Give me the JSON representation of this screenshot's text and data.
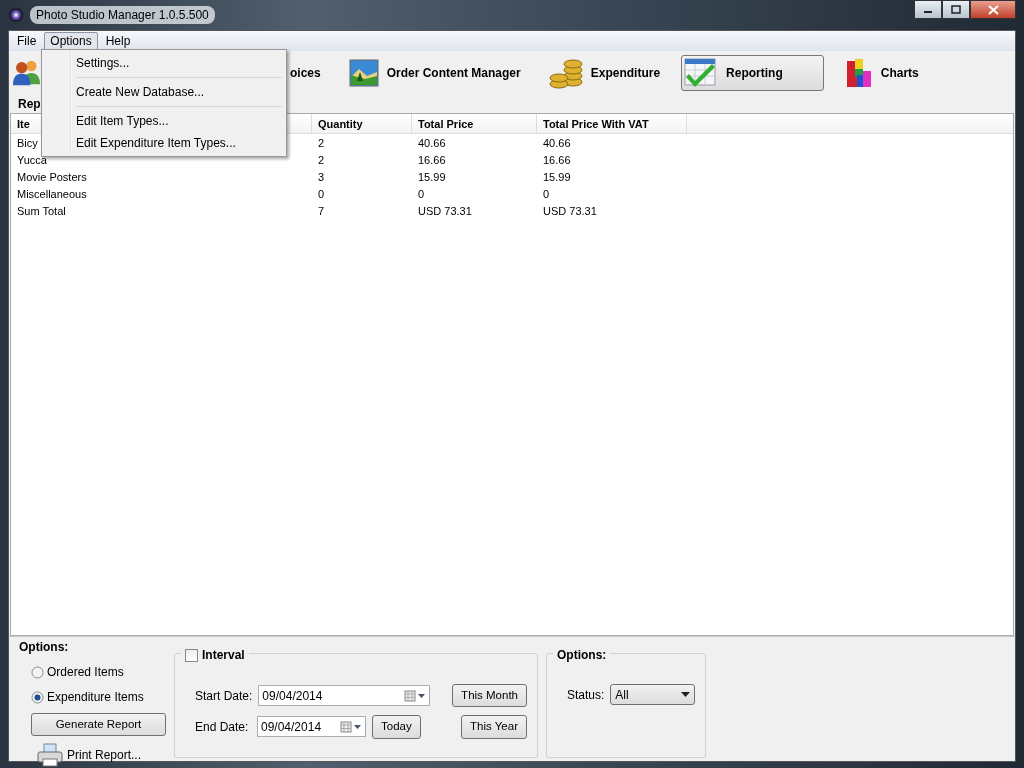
{
  "window": {
    "title": "Photo Studio Manager 1.0.5.500"
  },
  "menu_bar": [
    {
      "label": "File",
      "selected": false
    },
    {
      "label": "Options",
      "selected": true
    },
    {
      "label": "Help",
      "selected": false
    }
  ],
  "open_menu": {
    "groups": [
      [
        "Settings..."
      ],
      [
        "Create New Database..."
      ],
      [
        "Edit Item Types...",
        "Edit Expenditure Item Types..."
      ]
    ]
  },
  "toolbar": [
    {
      "kind": "people",
      "selected": false
    },
    {
      "kind": "text",
      "label": "oices",
      "selected": false
    },
    {
      "kind": "landscape",
      "label": "Order Content Manager",
      "selected": false
    },
    {
      "kind": "coins",
      "label": "Expenditure",
      "selected": false
    },
    {
      "kind": "report",
      "label": "Reporting",
      "selected": true
    },
    {
      "kind": "blocks",
      "label": "Charts",
      "selected": false
    }
  ],
  "report": {
    "title": "Rep",
    "table": {
      "columns": [
        "Ite",
        "Quantity",
        "Total Price",
        "Total Price With VAT"
      ],
      "rows": [
        [
          "Bicy",
          "2",
          "40.66",
          "40.66"
        ],
        [
          "Yucca",
          "2",
          "16.66",
          "16.66"
        ],
        [
          "Movie Posters",
          "3",
          "15.99",
          "15.99"
        ],
        [
          "Miscellaneous",
          "0",
          "0",
          "0"
        ],
        [
          "Sum Total",
          "7",
          "USD 73.31",
          "USD 73.31"
        ]
      ]
    }
  },
  "options": {
    "title": "Options:",
    "report_types": [
      {
        "label": "Ordered Items",
        "selected": false
      },
      {
        "label": "Expenditure Items",
        "selected": true
      }
    ],
    "generate_button": "Generate Report",
    "print_link": "Print Report...",
    "interval": {
      "label": "Interval",
      "checked": false,
      "start_label": "Start Date:",
      "start_value": "09/04/2014",
      "end_label": "End Date:",
      "end_value": "09/04/2014",
      "today_button": "Today",
      "this_month_button": "This Month",
      "this_year_button": "This Year"
    },
    "filter": {
      "title": "Options:",
      "status_label": "Status:",
      "status_value": "All"
    }
  }
}
